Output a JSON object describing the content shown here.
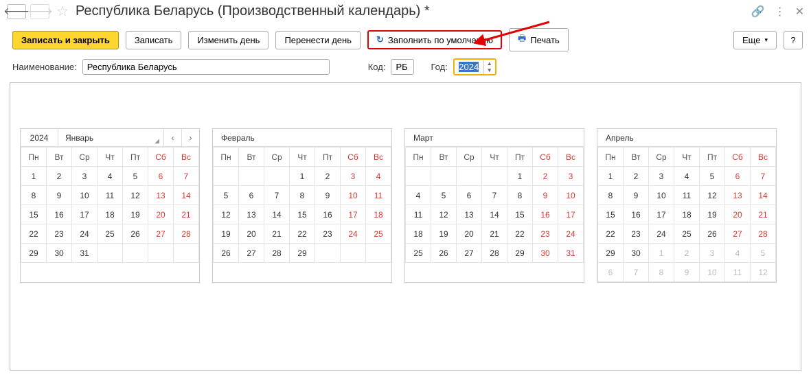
{
  "title": "Республика Беларусь (Производственный календарь) *",
  "toolbar": {
    "save_close": "Записать и закрыть",
    "save": "Записать",
    "change_day": "Изменить день",
    "move_day": "Перенести день",
    "fill_default": "Заполнить по умолчанию",
    "print": "Печать",
    "more": "Еще",
    "help": "?"
  },
  "form": {
    "name_label": "Наименование:",
    "name_value": "Республика Беларусь",
    "code_label": "Код:",
    "code_value": "РБ",
    "year_label": "Год:",
    "year_value": "2024"
  },
  "weekdays": [
    "Пн",
    "Вт",
    "Ср",
    "Чт",
    "Пт",
    "Сб",
    "Вс"
  ],
  "months": [
    {
      "year_cell": "2024",
      "name": "Январь",
      "has_year": true,
      "weeks": [
        [
          {
            "d": "1"
          },
          {
            "d": "2"
          },
          {
            "d": "3"
          },
          {
            "d": "4"
          },
          {
            "d": "5"
          },
          {
            "d": "6",
            "w": true
          },
          {
            "d": "7",
            "w": true
          }
        ],
        [
          {
            "d": "8"
          },
          {
            "d": "9"
          },
          {
            "d": "10"
          },
          {
            "d": "11"
          },
          {
            "d": "12"
          },
          {
            "d": "13",
            "w": true
          },
          {
            "d": "14",
            "w": true
          }
        ],
        [
          {
            "d": "15"
          },
          {
            "d": "16"
          },
          {
            "d": "17"
          },
          {
            "d": "18"
          },
          {
            "d": "19"
          },
          {
            "d": "20",
            "w": true
          },
          {
            "d": "21",
            "w": true
          }
        ],
        [
          {
            "d": "22"
          },
          {
            "d": "23"
          },
          {
            "d": "24"
          },
          {
            "d": "25"
          },
          {
            "d": "26"
          },
          {
            "d": "27",
            "w": true
          },
          {
            "d": "28",
            "w": true
          }
        ],
        [
          {
            "d": "29"
          },
          {
            "d": "30"
          },
          {
            "d": "31"
          },
          {
            "d": "",
            "e": true
          },
          {
            "d": "",
            "e": true
          },
          {
            "d": "",
            "e": true
          },
          {
            "d": "",
            "e": true
          }
        ]
      ]
    },
    {
      "name": "Февраль",
      "weeks": [
        [
          {
            "d": "",
            "e": true
          },
          {
            "d": "",
            "e": true
          },
          {
            "d": "",
            "e": true
          },
          {
            "d": "1"
          },
          {
            "d": "2"
          },
          {
            "d": "3",
            "w": true
          },
          {
            "d": "4",
            "w": true
          }
        ],
        [
          {
            "d": "5"
          },
          {
            "d": "6"
          },
          {
            "d": "7"
          },
          {
            "d": "8"
          },
          {
            "d": "9"
          },
          {
            "d": "10",
            "w": true
          },
          {
            "d": "11",
            "w": true
          }
        ],
        [
          {
            "d": "12"
          },
          {
            "d": "13"
          },
          {
            "d": "14"
          },
          {
            "d": "15"
          },
          {
            "d": "16"
          },
          {
            "d": "17",
            "w": true
          },
          {
            "d": "18",
            "w": true
          }
        ],
        [
          {
            "d": "19"
          },
          {
            "d": "20"
          },
          {
            "d": "21"
          },
          {
            "d": "22"
          },
          {
            "d": "23"
          },
          {
            "d": "24",
            "w": true
          },
          {
            "d": "25",
            "w": true
          }
        ],
        [
          {
            "d": "26"
          },
          {
            "d": "27"
          },
          {
            "d": "28"
          },
          {
            "d": "29"
          },
          {
            "d": "",
            "e": true
          },
          {
            "d": "",
            "e": true
          },
          {
            "d": "",
            "e": true
          }
        ]
      ]
    },
    {
      "name": "Март",
      "weeks": [
        [
          {
            "d": "",
            "e": true
          },
          {
            "d": "",
            "e": true
          },
          {
            "d": "",
            "e": true
          },
          {
            "d": "",
            "e": true
          },
          {
            "d": "1"
          },
          {
            "d": "2",
            "w": true
          },
          {
            "d": "3",
            "w": true
          }
        ],
        [
          {
            "d": "4"
          },
          {
            "d": "5"
          },
          {
            "d": "6"
          },
          {
            "d": "7"
          },
          {
            "d": "8"
          },
          {
            "d": "9",
            "w": true
          },
          {
            "d": "10",
            "w": true
          }
        ],
        [
          {
            "d": "11"
          },
          {
            "d": "12"
          },
          {
            "d": "13"
          },
          {
            "d": "14"
          },
          {
            "d": "15"
          },
          {
            "d": "16",
            "w": true
          },
          {
            "d": "17",
            "w": true
          }
        ],
        [
          {
            "d": "18"
          },
          {
            "d": "19"
          },
          {
            "d": "20"
          },
          {
            "d": "21"
          },
          {
            "d": "22"
          },
          {
            "d": "23",
            "w": true
          },
          {
            "d": "24",
            "w": true
          }
        ],
        [
          {
            "d": "25"
          },
          {
            "d": "26"
          },
          {
            "d": "27"
          },
          {
            "d": "28"
          },
          {
            "d": "29"
          },
          {
            "d": "30",
            "w": true
          },
          {
            "d": "31",
            "w": true
          }
        ]
      ]
    },
    {
      "name": "Апрель",
      "weeks": [
        [
          {
            "d": "1"
          },
          {
            "d": "2"
          },
          {
            "d": "3"
          },
          {
            "d": "4"
          },
          {
            "d": "5"
          },
          {
            "d": "6",
            "w": true
          },
          {
            "d": "7",
            "w": true
          }
        ],
        [
          {
            "d": "8"
          },
          {
            "d": "9"
          },
          {
            "d": "10"
          },
          {
            "d": "11"
          },
          {
            "d": "12"
          },
          {
            "d": "13",
            "w": true
          },
          {
            "d": "14",
            "w": true
          }
        ],
        [
          {
            "d": "15"
          },
          {
            "d": "16"
          },
          {
            "d": "17"
          },
          {
            "d": "18"
          },
          {
            "d": "19"
          },
          {
            "d": "20",
            "w": true
          },
          {
            "d": "21",
            "w": true
          }
        ],
        [
          {
            "d": "22"
          },
          {
            "d": "23"
          },
          {
            "d": "24"
          },
          {
            "d": "25"
          },
          {
            "d": "26"
          },
          {
            "d": "27",
            "w": true
          },
          {
            "d": "28",
            "w": true
          }
        ],
        [
          {
            "d": "29"
          },
          {
            "d": "30"
          },
          {
            "d": "1",
            "o": true
          },
          {
            "d": "2",
            "o": true
          },
          {
            "d": "3",
            "o": true
          },
          {
            "d": "4",
            "o": true
          },
          {
            "d": "5",
            "o": true
          }
        ],
        [
          {
            "d": "6",
            "o": true
          },
          {
            "d": "7",
            "o": true
          },
          {
            "d": "8",
            "o": true
          },
          {
            "d": "9",
            "o": true
          },
          {
            "d": "10",
            "o": true
          },
          {
            "d": "11",
            "o": true
          },
          {
            "d": "12",
            "o": true
          }
        ]
      ]
    }
  ]
}
